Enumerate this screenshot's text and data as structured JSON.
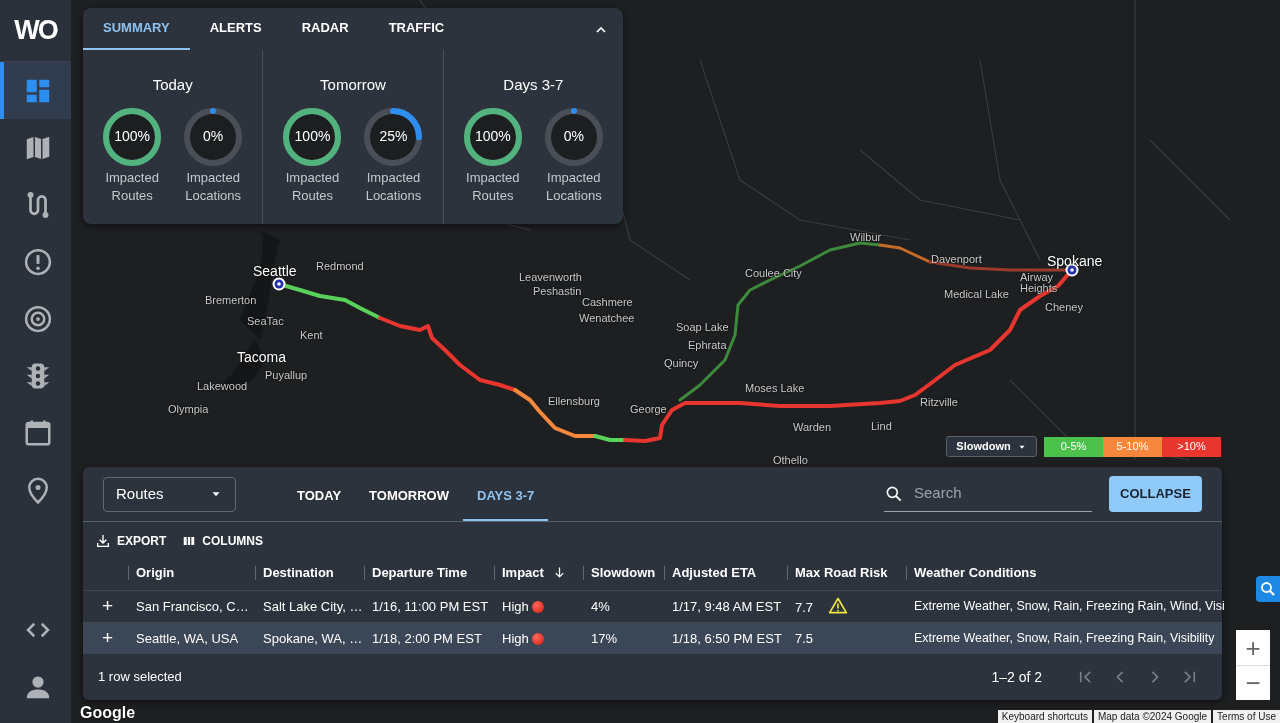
{
  "sidebar": {
    "logo": "WO",
    "items": [
      {
        "selected": true
      },
      {
        "selected": false
      },
      {
        "selected": false
      },
      {
        "selected": false
      },
      {
        "selected": false
      },
      {
        "selected": false
      },
      {
        "selected": false
      },
      {
        "selected": false
      }
    ]
  },
  "summary": {
    "tabs": [
      {
        "label": "SUMMARY",
        "selected": true
      },
      {
        "label": "ALERTS",
        "selected": false
      },
      {
        "label": "RADAR",
        "selected": false
      },
      {
        "label": "TRAFFIC",
        "selected": false
      }
    ],
    "periods": [
      {
        "title": "Today",
        "gauges": [
          {
            "value": "100%",
            "label": "Impacted Routes",
            "level": 1,
            "color": "#52b37f"
          },
          {
            "value": "0%",
            "label": "Impacted Locations",
            "level": 0,
            "color": "#2e8ef0"
          }
        ]
      },
      {
        "title": "Tomorrow",
        "gauges": [
          {
            "value": "100%",
            "label": "Impacted Routes",
            "level": 1,
            "color": "#52b37f"
          },
          {
            "value": "25%",
            "label": "Impacted Locations",
            "level": 0.25,
            "color": "#2e8ef0"
          }
        ]
      },
      {
        "title": "Days 3-7",
        "gauges": [
          {
            "value": "100%",
            "label": "Impacted Routes",
            "level": 1,
            "color": "#52b37f"
          },
          {
            "value": "0%",
            "label": "Impacted Locations",
            "level": 0,
            "color": "#2e8ef0"
          }
        ]
      }
    ]
  },
  "map": {
    "labels": [
      {
        "text": "Seattle",
        "kind": "major"
      },
      {
        "text": "Redmond",
        "kind": "city"
      },
      {
        "text": "Bremerton",
        "kind": "city"
      },
      {
        "text": "SeaTac",
        "kind": "city"
      },
      {
        "text": "Kent",
        "kind": "city"
      },
      {
        "text": "Tacoma",
        "kind": "major"
      },
      {
        "text": "Puyallup",
        "kind": "city"
      },
      {
        "text": "Lakewood",
        "kind": "city"
      },
      {
        "text": "Olympia",
        "kind": "city"
      },
      {
        "text": "Leavenworth",
        "kind": "city"
      },
      {
        "text": "Peshastin",
        "kind": "city"
      },
      {
        "text": "Cashmere",
        "kind": "city"
      },
      {
        "text": "Wenatchee",
        "kind": "city"
      },
      {
        "text": "Ellensburg",
        "kind": "city"
      },
      {
        "text": "Quincy",
        "kind": "city"
      },
      {
        "text": "George",
        "kind": "city"
      },
      {
        "text": "Soap Lake",
        "kind": "city"
      },
      {
        "text": "Ephrata",
        "kind": "city"
      },
      {
        "text": "Coulee City",
        "kind": "city"
      },
      {
        "text": "Wilbur",
        "kind": "city"
      },
      {
        "text": "Davenport",
        "kind": "city"
      },
      {
        "text": "Moses Lake",
        "kind": "city"
      },
      {
        "text": "Ritzville",
        "kind": "city"
      },
      {
        "text": "Warden",
        "kind": "city"
      },
      {
        "text": "Lind",
        "kind": "city"
      },
      {
        "text": "Othello",
        "kind": "city"
      },
      {
        "text": "Spokane",
        "kind": "major"
      },
      {
        "text": "Cheney",
        "kind": "city"
      },
      {
        "text": "Medical Lake",
        "kind": "city"
      },
      {
        "text": "Airway Heights",
        "kind": "city"
      }
    ],
    "legend": {
      "metric": "Slowdown",
      "bands": [
        {
          "label": "0-5%",
          "color": "#4cc24c"
        },
        {
          "label": "5-10%",
          "color": "#f5883d"
        },
        {
          "label": ">10%",
          "color": "#e8352e"
        }
      ]
    },
    "zoom": {
      "in": "+",
      "out": "−"
    },
    "brand": "Google",
    "footer": [
      "Keyboard shortcuts",
      "Map data ©2024 Google",
      "Terms of Use"
    ]
  },
  "routes_panel": {
    "view": "Routes",
    "tabs": [
      {
        "label": "TODAY",
        "selected": false
      },
      {
        "label": "TOMORROW",
        "selected": false
      },
      {
        "label": "DAYS 3-7",
        "selected": true
      }
    ],
    "search": {
      "placeholder": "Search"
    },
    "collapse": "COLLAPSE",
    "export": "EXPORT",
    "columns_button": "COLUMNS",
    "columns": [
      {
        "label": "Origin",
        "sorted": false
      },
      {
        "label": "Destination",
        "sorted": false
      },
      {
        "label": "Departure Time",
        "sorted": false
      },
      {
        "label": "Impact",
        "sorted": true
      },
      {
        "label": "Slowdown",
        "sorted": false
      },
      {
        "label": "Adjusted ETA",
        "sorted": false
      },
      {
        "label": "Max Road Risk",
        "sorted": false
      },
      {
        "label": "Weather Conditions",
        "sorted": false
      }
    ],
    "rows": [
      {
        "selected": false,
        "expand": "+",
        "origin": "San Francisco, C…",
        "destination": "Salt Lake City, …",
        "departure": "1/16, 11:00 PM EST",
        "impact": "High",
        "impact_dot": true,
        "slowdown": "4%",
        "eta": "1/17, 9:48 AM EST",
        "risk": "7.7",
        "warning": true,
        "weather": "Extreme Weather, Snow, Rain, Freezing Rain, Wind, Visi"
      },
      {
        "selected": true,
        "expand": "+",
        "origin": "Seattle, WA, USA",
        "destination": "Spokane, WA, …",
        "departure": "1/18, 2:00 PM EST",
        "impact": "High",
        "impact_dot": true,
        "slowdown": "17%",
        "eta": "1/18, 6:50 PM EST",
        "risk": "7.5",
        "warning": false,
        "weather": "Extreme Weather, Snow, Rain, Freezing Rain, Visibility"
      }
    ],
    "selection": "1 row selected",
    "range": "1–2 of 2"
  }
}
